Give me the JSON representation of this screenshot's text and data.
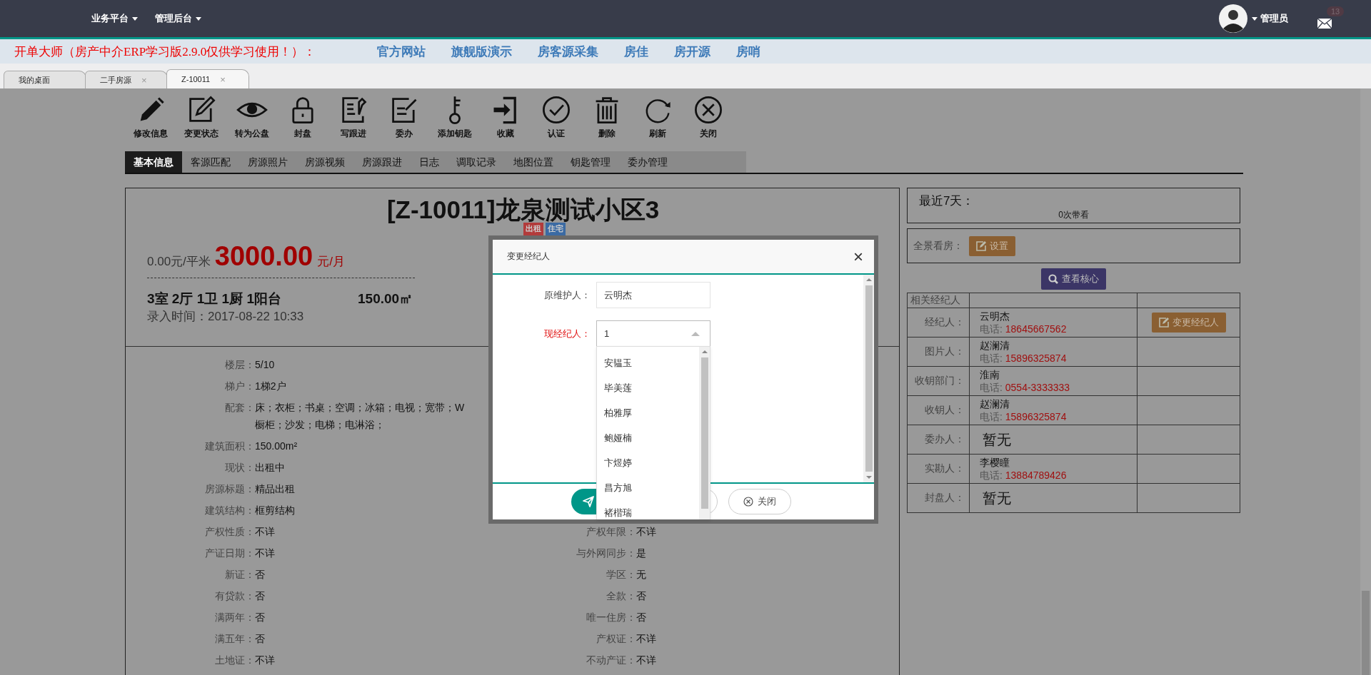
{
  "top_nav": {
    "menus": [
      {
        "label": "业务平台"
      },
      {
        "label": "管理后台"
      }
    ],
    "user": {
      "name": "管理员"
    },
    "mail_badge": "13"
  },
  "banner": {
    "notice": "开单大师（房产中介ERP学习版2.9.0仅供学习使用！）：",
    "links": [
      "官方网站",
      "旗舰版演示",
      "房客源采集",
      "房佳",
      "房开源",
      "房哨"
    ]
  },
  "page_tabs": [
    {
      "label": "我的桌面",
      "selected": false
    },
    {
      "label": "二手房源",
      "selected": false,
      "close_mark": "×"
    },
    {
      "label": "Z-10011",
      "selected": true,
      "close_mark": "×"
    }
  ],
  "toolbar": [
    {
      "label": "修改信息"
    },
    {
      "label": "变更状态"
    },
    {
      "label": "转为公盘"
    },
    {
      "label": "封盘"
    },
    {
      "label": "写跟进"
    },
    {
      "label": "委办"
    },
    {
      "label": "添加钥匙"
    },
    {
      "label": "收藏"
    },
    {
      "label": "认证"
    },
    {
      "label": "删除"
    },
    {
      "label": "刷新"
    },
    {
      "label": "关闭"
    }
  ],
  "detail_tabs": [
    {
      "label": "基本信息",
      "selected": true
    },
    {
      "label": "客源匹配",
      "selected": false
    },
    {
      "label": "房源照片",
      "selected": false
    },
    {
      "label": "房源视频",
      "selected": false
    },
    {
      "label": "房源跟进",
      "selected": false
    },
    {
      "label": "日志",
      "selected": false
    },
    {
      "label": "调取记录",
      "selected": false
    },
    {
      "label": "地图位置",
      "selected": false
    },
    {
      "label": "钥匙管理",
      "selected": false
    },
    {
      "label": "委办管理",
      "selected": false
    }
  ],
  "listing": {
    "title": "[Z-10011]龙泉测试小区3",
    "tags": [
      {
        "label": "出租",
        "color": "#b23b3b"
      },
      {
        "label": "住宅",
        "color": "#3b6aa3"
      }
    ],
    "unit_price": "0.00元/平米",
    "price": "3000.00",
    "price_unit": "元/月",
    "layout": "3室 2厅 1卫 1厨 1阳台",
    "area": "150.00㎡",
    "entry_time": "录入时间：2017-08-22 10:33",
    "rows": [
      {
        "left": {
          "label": "楼层：",
          "value": [
            "5/10"
          ]
        }
      },
      {
        "left": {
          "label": "梯户：",
          "value": [
            "1梯2户"
          ]
        }
      },
      {
        "left": {
          "label": "配套：",
          "value": [
            "床；衣柜；书桌；空调；冰箱；电视；宽带；W",
            "橱柜；沙发；电梯；电淋浴；"
          ]
        }
      },
      {
        "left": {
          "label": "建筑面积：",
          "value": [
            "150.00m²"
          ]
        }
      },
      {
        "left": {
          "label": "现状：",
          "value": [
            "出租中"
          ]
        }
      },
      {
        "left": {
          "label": "房源标题：",
          "value": [
            "精品出租"
          ]
        }
      },
      {
        "left": {
          "label": "建筑结构：",
          "value": [
            "框剪结构"
          ]
        }
      },
      {
        "left": {
          "label": "产权性质：",
          "value": [
            "不详"
          ]
        },
        "right": {
          "label": "产权年限：",
          "value": [
            "不详"
          ]
        }
      },
      {
        "left": {
          "label": "产证日期：",
          "value": [
            "不详"
          ]
        },
        "right": {
          "label": "与外网同步：",
          "value": [
            "是"
          ]
        }
      },
      {
        "left": {
          "label": "新证：",
          "value": [
            "否"
          ]
        },
        "right": {
          "label": "学区：",
          "value": [
            "无"
          ]
        }
      },
      {
        "left": {
          "label": "有贷款：",
          "value": [
            "否"
          ]
        },
        "right": {
          "label": "全款：",
          "value": [
            "否"
          ]
        }
      },
      {
        "left": {
          "label": "满两年：",
          "value": [
            "否"
          ]
        },
        "right": {
          "label": "唯一住房：",
          "value": [
            "否"
          ]
        }
      },
      {
        "left": {
          "label": "满五年：",
          "value": [
            "否"
          ]
        },
        "right": {
          "label": "产权证：",
          "value": [
            "不详"
          ]
        }
      },
      {
        "left": {
          "label": "土地证：",
          "value": [
            "不详"
          ]
        },
        "right": {
          "label": "不动产证：",
          "value": [
            "不详"
          ]
        }
      }
    ]
  },
  "side_panel": {
    "recent_label": "最近7天：",
    "recent_value": "0次带看",
    "panorama_label": "全景看房：",
    "panorama_button": "设置",
    "core_button": "查看核心",
    "agents_header": "相关经纪人",
    "agents": [
      {
        "kind": "person",
        "label": "经纪人：",
        "name": "云明杰",
        "phone_label": "电话:",
        "phone": "18645667562",
        "action": "变更经纪人"
      },
      {
        "kind": "person",
        "label": "图片人：",
        "name": "赵澜清",
        "phone_label": "电话:",
        "phone": "15896325874"
      },
      {
        "kind": "person",
        "label": "收钥部门：",
        "name": "淮南",
        "phone_label": "电话:",
        "phone": "0554-3333333"
      },
      {
        "kind": "person",
        "label": "收钥人：",
        "name": "赵澜清",
        "phone_label": "电话:",
        "phone": "15896325874"
      },
      {
        "kind": "none",
        "label": "委办人：",
        "name": "暂无"
      },
      {
        "kind": "person",
        "label": "实勘人：",
        "name": "李樱瞳",
        "phone_label": "电话:",
        "phone": "13884789426"
      },
      {
        "kind": "none",
        "label": "封盘人：",
        "name": "暂无"
      }
    ]
  },
  "dialog": {
    "title": "变更经纪人",
    "close_mark": "×",
    "fields": [
      {
        "kind": "text",
        "label": "原维护人：",
        "required": false,
        "value": "云明杰"
      },
      {
        "kind": "select",
        "label": "现经纪人：",
        "required": true,
        "value": "1",
        "expanded": true
      }
    ],
    "options": [
      "安韫玉",
      "毕美莲",
      "柏雅厚",
      "鲍娅楠",
      "卞煜婷",
      "昌方旭",
      "褚楷瑞"
    ],
    "close_button": "关闭"
  }
}
